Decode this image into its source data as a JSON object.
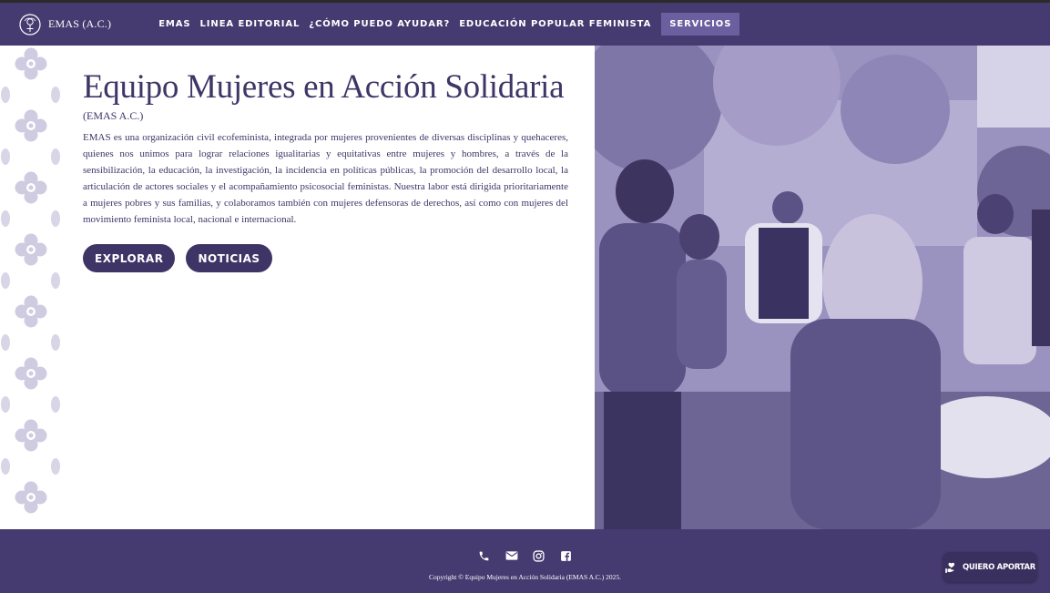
{
  "brand": {
    "name": "EMAS (A.C.)",
    "accent": "#463b70",
    "active_nav": "#6c5fa0",
    "text_color": "#3f3567"
  },
  "nav": {
    "items": [
      {
        "label": "EMAS"
      },
      {
        "label": "LINEA EDITORIAL"
      },
      {
        "label": "¿CÓMO PUEDO AYUDAR?"
      },
      {
        "label": "EDUCACIÓN POPULAR FEMINISTA"
      },
      {
        "label": "SERVICIOS"
      }
    ],
    "active_index": 4
  },
  "hero": {
    "title": "Equipo Mujeres en Acción Solidaria",
    "subtitle": "(EMAS A.C.)",
    "description": "EMAS es una organización civil ecofeminista, integrada por mujeres provenientes de diversas disciplinas y quehaceres, quienes nos unimos para lograr relaciones igualitarias y equitativas entre mujeres y hombres, a través de la sensibilización, la educación, la investigación, la incidencia en políticas públicas, la promoción del desarrollo local, la articulación de actores sociales y el acompañamiento psicosocial feministas. Nuestra labor está dirigida prioritariamente a mujeres pobres y sus familias, y colaboramos también con mujeres defensoras de derechos, así como con mujeres del movimiento feminista local, nacional e internacional.",
    "buttons": {
      "explore": "EXPLORAR",
      "news": "NOTICIAS"
    }
  },
  "footer": {
    "icons": [
      "phone-icon",
      "email-icon",
      "instagram-icon",
      "facebook-icon"
    ],
    "copyright": "Copyright © Equipo Mujeres en Acción Solidaria (EMAS A.C.) 2025.",
    "donate_label": "QUIERO APORTAR"
  }
}
